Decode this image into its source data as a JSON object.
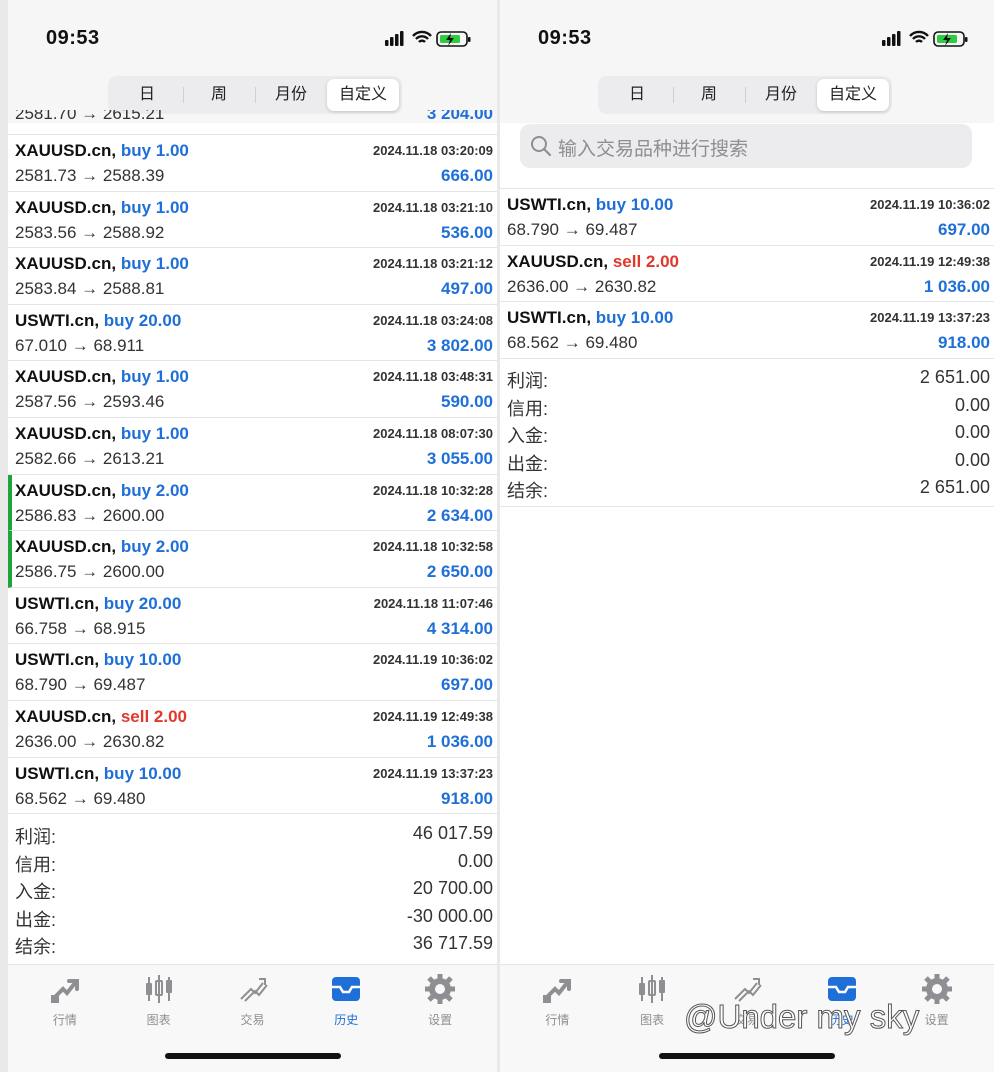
{
  "status": {
    "time": "09:53"
  },
  "period_tabs": [
    "日",
    "周",
    "月份",
    "自定义"
  ],
  "left": {
    "partial_row": {
      "prices": "2581.70 → 2615.21",
      "profit": "3 204.00"
    },
    "trades": [
      {
        "symbol": "XAUUSD.cn,",
        "dir": "buy",
        "volume": "1.00",
        "time": "2024.11.18 03:20:09",
        "prices": "2581.73 → 2588.39",
        "profit": "666.00",
        "marked": false
      },
      {
        "symbol": "XAUUSD.cn,",
        "dir": "buy",
        "volume": "1.00",
        "time": "2024.11.18 03:21:10",
        "prices": "2583.56 → 2588.92",
        "profit": "536.00",
        "marked": false
      },
      {
        "symbol": "XAUUSD.cn,",
        "dir": "buy",
        "volume": "1.00",
        "time": "2024.11.18 03:21:12",
        "prices": "2583.84 → 2588.81",
        "profit": "497.00",
        "marked": false
      },
      {
        "symbol": "USWTI.cn,",
        "dir": "buy",
        "volume": "20.00",
        "time": "2024.11.18 03:24:08",
        "prices": "67.010 → 68.911",
        "profit": "3 802.00",
        "marked": false
      },
      {
        "symbol": "XAUUSD.cn,",
        "dir": "buy",
        "volume": "1.00",
        "time": "2024.11.18 03:48:31",
        "prices": "2587.56 → 2593.46",
        "profit": "590.00",
        "marked": false
      },
      {
        "symbol": "XAUUSD.cn,",
        "dir": "buy",
        "volume": "1.00",
        "time": "2024.11.18 08:07:30",
        "prices": "2582.66 → 2613.21",
        "profit": "3 055.00",
        "marked": false
      },
      {
        "symbol": "XAUUSD.cn,",
        "dir": "buy",
        "volume": "2.00",
        "time": "2024.11.18 10:32:28",
        "prices": "2586.83 → 2600.00",
        "profit": "2 634.00",
        "marked": true
      },
      {
        "symbol": "XAUUSD.cn,",
        "dir": "buy",
        "volume": "2.00",
        "time": "2024.11.18 10:32:58",
        "prices": "2586.75 → 2600.00",
        "profit": "2 650.00",
        "marked": true
      },
      {
        "symbol": "USWTI.cn,",
        "dir": "buy",
        "volume": "20.00",
        "time": "2024.11.18 11:07:46",
        "prices": "66.758 → 68.915",
        "profit": "4 314.00",
        "marked": false
      },
      {
        "symbol": "USWTI.cn,",
        "dir": "buy",
        "volume": "10.00",
        "time": "2024.11.19 10:36:02",
        "prices": "68.790 → 69.487",
        "profit": "697.00",
        "marked": false
      },
      {
        "symbol": "XAUUSD.cn,",
        "dir": "sell",
        "volume": "2.00",
        "time": "2024.11.19 12:49:38",
        "prices": "2636.00 → 2630.82",
        "profit": "1 036.00",
        "marked": false
      },
      {
        "symbol": "USWTI.cn,",
        "dir": "buy",
        "volume": "10.00",
        "time": "2024.11.19 13:37:23",
        "prices": "68.562 → 69.480",
        "profit": "918.00",
        "marked": false
      }
    ],
    "summary": [
      {
        "label": "利润:",
        "value": "46 017.59"
      },
      {
        "label": "信用:",
        "value": "0.00"
      },
      {
        "label": "入金:",
        "value": "20 700.00"
      },
      {
        "label": "出金:",
        "value": "-30 000.00"
      },
      {
        "label": "结余:",
        "value": "36 717.59"
      }
    ]
  },
  "right": {
    "search_placeholder": "输入交易品种进行搜索",
    "trades": [
      {
        "symbol": "USWTI.cn,",
        "dir": "buy",
        "volume": "10.00",
        "time": "2024.11.19 10:36:02",
        "prices": "68.790 → 69.487",
        "profit": "697.00",
        "marked": false
      },
      {
        "symbol": "XAUUSD.cn,",
        "dir": "sell",
        "volume": "2.00",
        "time": "2024.11.19 12:49:38",
        "prices": "2636.00 → 2630.82",
        "profit": "1 036.00",
        "marked": false
      },
      {
        "symbol": "USWTI.cn,",
        "dir": "buy",
        "volume": "10.00",
        "time": "2024.11.19 13:37:23",
        "prices": "68.562 → 69.480",
        "profit": "918.00",
        "marked": false
      }
    ],
    "summary": [
      {
        "label": "利润:",
        "value": "2 651.00"
      },
      {
        "label": "信用:",
        "value": "0.00"
      },
      {
        "label": "入金:",
        "value": "0.00"
      },
      {
        "label": "出金:",
        "value": "0.00"
      },
      {
        "label": "结余:",
        "value": "2 651.00"
      }
    ]
  },
  "bottom_tabs": [
    {
      "label": "行情",
      "icon": "quotes-icon"
    },
    {
      "label": "图表",
      "icon": "chart-icon"
    },
    {
      "label": "交易",
      "icon": "trade-icon"
    },
    {
      "label": "历史",
      "icon": "history-icon"
    },
    {
      "label": "设置",
      "icon": "settings-icon"
    }
  ],
  "active_bottom_tab": "历史",
  "watermark": "@Under my sky",
  "colors": {
    "accent": "#1f6fd8",
    "sell": "#e0382c",
    "marker": "#1fa33a"
  }
}
